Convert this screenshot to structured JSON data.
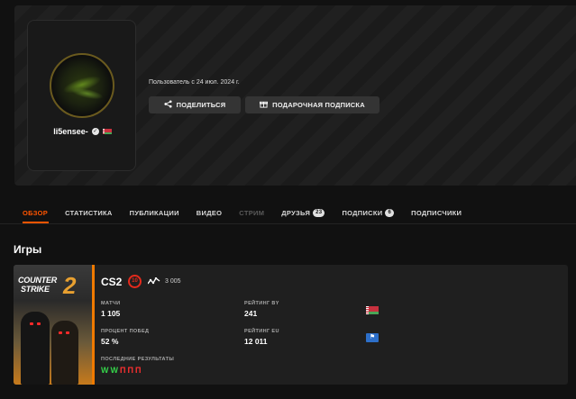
{
  "profile": {
    "username": "li5ensee-",
    "member_since": "Пользователь с 24 июл. 2024 г.",
    "share_label": "ПОДЕЛИТЬСЯ",
    "gift_label": "ПОДАРОЧНАЯ ПОДПИСКА"
  },
  "tabs": [
    {
      "label": "ОБЗОР",
      "state": "active"
    },
    {
      "label": "СТАТИСТИКА",
      "state": "normal"
    },
    {
      "label": "ПУБЛИКАЦИИ",
      "state": "normal"
    },
    {
      "label": "ВИДЕО",
      "state": "normal"
    },
    {
      "label": "СТРИМ",
      "state": "disabled"
    },
    {
      "label": "ДРУЗЬЯ",
      "state": "normal",
      "badge": "23"
    },
    {
      "label": "ПОДПИСКИ",
      "state": "normal",
      "badge": "6"
    },
    {
      "label": "ПОДПИСЧИКИ",
      "state": "normal"
    }
  ],
  "games_section": {
    "title": "Игры",
    "game": {
      "cover_title_line1": "COUNTER",
      "cover_title_line2": "STRIKE",
      "cover_number": "2",
      "name": "CS2",
      "level": "10",
      "elo": "3 005",
      "stats": {
        "matches_label": "МАТЧИ",
        "matches_value": "1 105",
        "winrate_label": "ПРОЦЕНТ ПОБЕД",
        "winrate_value": "52 %",
        "rating_by_label": "РЕЙТИНГ BY",
        "rating_by_value": "241",
        "rating_eu_label": "РЕЙТИНГ EU",
        "rating_eu_value": "12 011",
        "recent_label": "ПОСЛЕДНИЕ РЕЗУЛЬТАТЫ"
      },
      "recent_results": [
        "W",
        "W",
        "П",
        "П",
        "П"
      ]
    }
  },
  "colors": {
    "accent": "#ff5500",
    "win": "#35d34a",
    "loss": "#ff3030",
    "level": "#e42a1c"
  },
  "icons": {
    "share": "share-icon",
    "gift": "gift-icon",
    "verified": "verified-icon",
    "elo": "elo-graph-icon"
  }
}
